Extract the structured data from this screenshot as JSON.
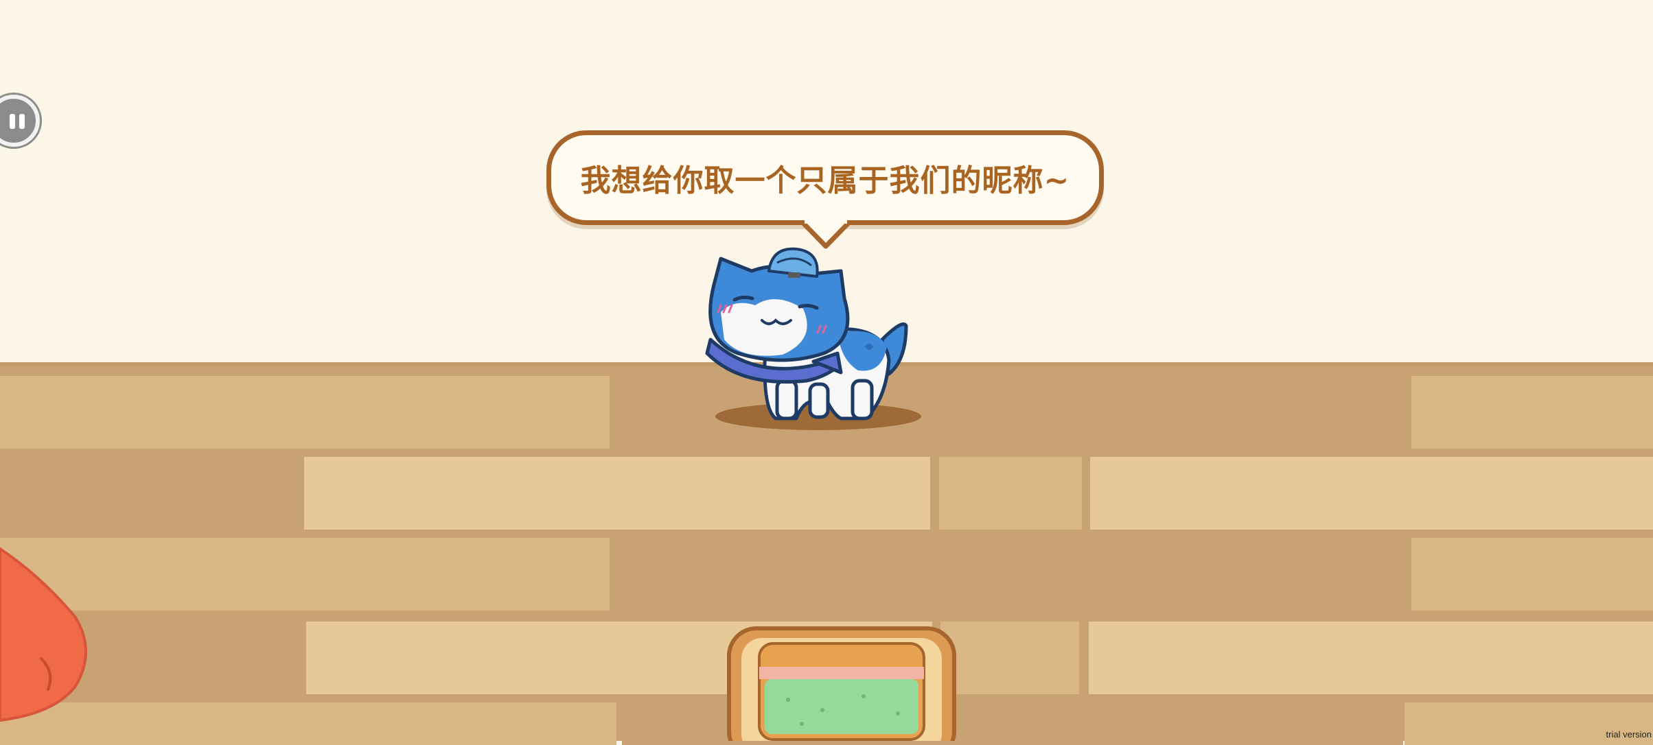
{
  "speech_bubble": {
    "text": "我想给你取一个只属于我们的昵称~"
  },
  "pause_button": {
    "icon": "pause-icon"
  },
  "watermark": {
    "text": "trial version"
  },
  "colors": {
    "wall": "#fbf6e8",
    "floor": "#c9a273",
    "speech_border": "#a8652b",
    "speech_text": "#a86420",
    "cat_blue": "#3f8ad8",
    "food_bowl_green": "#96d99a"
  }
}
